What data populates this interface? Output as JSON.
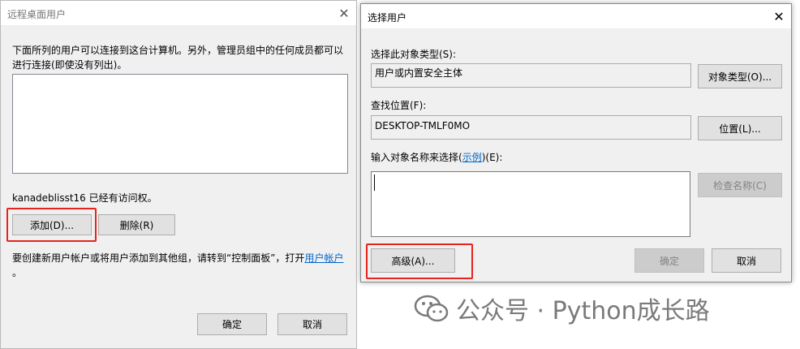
{
  "remote_dialog": {
    "title": "远程桌面用户",
    "description_line1": "下面所列的用户可以连接到这台计算机。另外，管理员组中的任何成员都可以",
    "description_line2": "进行连接(即使没有列出)。",
    "access_text": "kanadeblisst16 已经有访问权。",
    "add_button": "添加(D)...",
    "remove_button": "删除(R)",
    "note_prefix": "要创建新用户帐户或将用户添加到其他组，请转到“控制面板”，打开",
    "note_link": "用户帐户",
    "note_suffix": "。",
    "ok_button": "确定",
    "cancel_button": "取消"
  },
  "select_dialog": {
    "title": "选择用户",
    "object_type_label": "选择此对象类型(S):",
    "object_type_value": "用户或内置安全主体",
    "object_types_button": "对象类型(O)...",
    "location_label": "查找位置(F):",
    "location_value": "DESKTOP-TMLF0MO",
    "location_button": "位置(L)...",
    "enter_label_prefix": "输入对象名称来选择(",
    "enter_label_link": "示例",
    "enter_label_suffix": ")(E):",
    "check_names_button": "检查名称(C)",
    "advanced_button": "高级(A)...",
    "ok_button": "确定",
    "cancel_button": "取消"
  },
  "watermark": {
    "text": "公众号 · Python成长路"
  },
  "colors": {
    "highlight": "#e8231e",
    "link": "#0066cc"
  }
}
